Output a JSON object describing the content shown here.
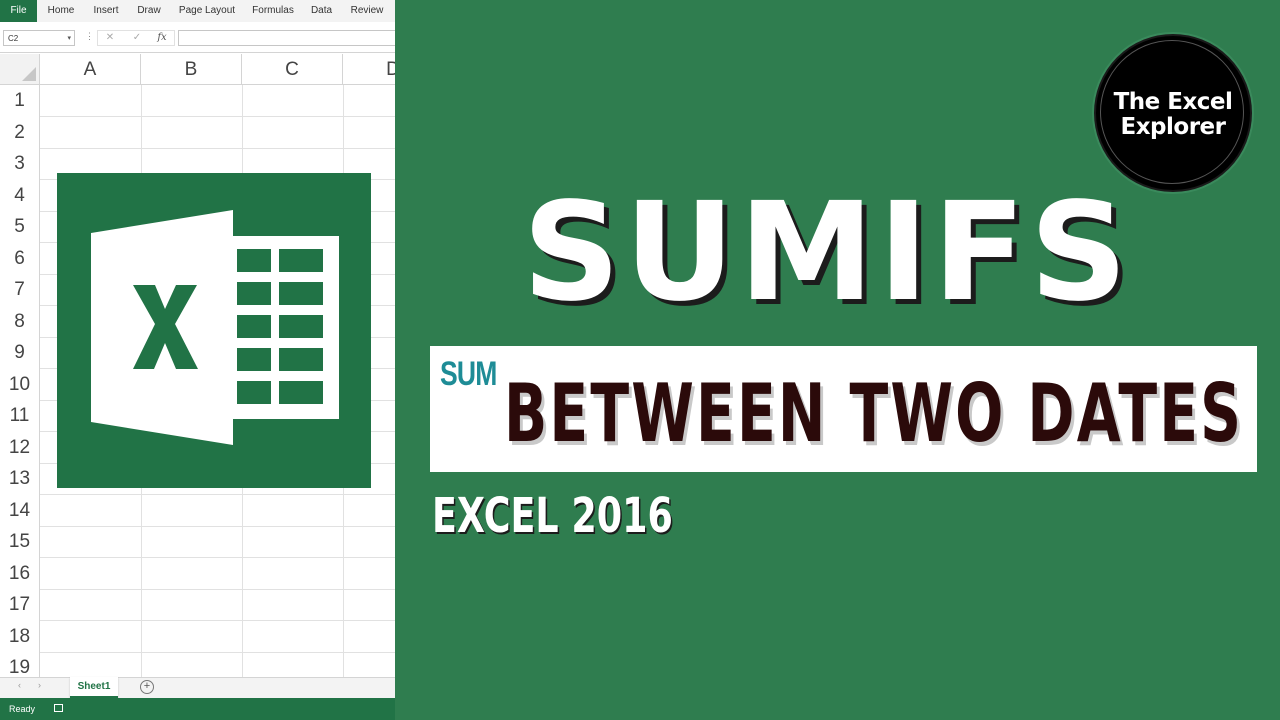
{
  "ribbon": {
    "tabs": [
      "File",
      "Home",
      "Insert",
      "Draw",
      "Page Layout",
      "Formulas",
      "Data",
      "Review"
    ]
  },
  "formula_bar": {
    "name_box": "C2",
    "cancel_icon": "x-icon",
    "enter_icon": "check-icon",
    "function_label": "fx",
    "formula_value": ""
  },
  "grid": {
    "columns": [
      "A",
      "B",
      "C",
      "D"
    ],
    "rows": [
      "1",
      "2",
      "3",
      "4",
      "5",
      "6",
      "7",
      "8",
      "9",
      "10",
      "11",
      "12",
      "13",
      "14",
      "15",
      "16",
      "17",
      "18",
      "19"
    ]
  },
  "sheets": {
    "active": "Sheet1",
    "add_label": "+"
  },
  "status": {
    "text": "Ready"
  },
  "promo": {
    "title": "SUMIFS",
    "banner_small": "SUM",
    "banner_main": "BETWEEN TWO DATES",
    "subtitle": "EXCEL 2016",
    "brand_line1": "The Excel",
    "brand_line2": "Explorer"
  },
  "colors": {
    "background_green": "#2f7d4f",
    "excel_green": "#217346",
    "sum_teal": "#1e8c96",
    "banner_text": "#2b0a0a"
  }
}
